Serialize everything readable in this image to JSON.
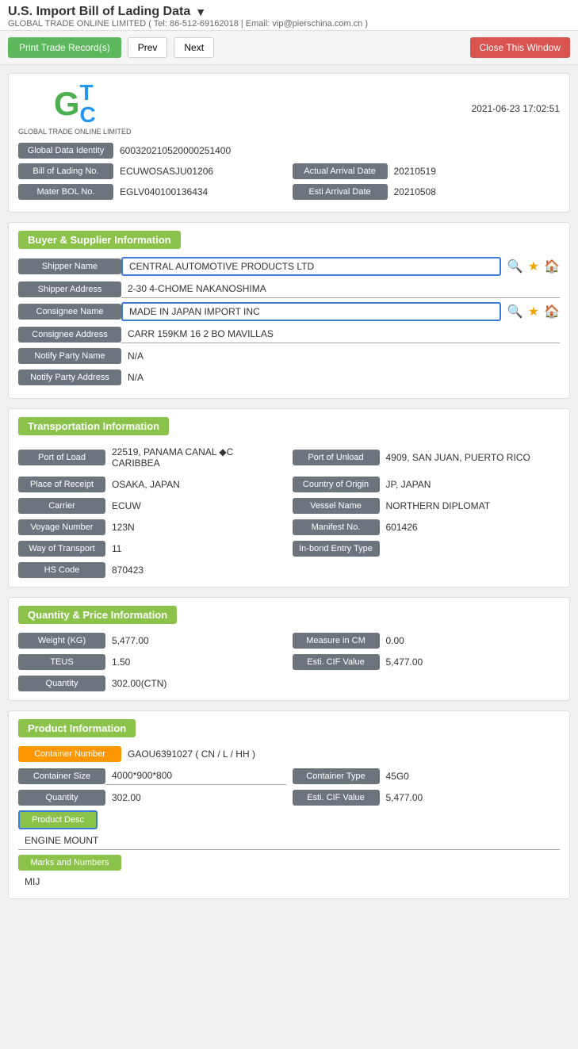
{
  "header": {
    "title": "U.S. Import Bill of Lading Data",
    "subtitle": "GLOBAL TRADE ONLINE LIMITED ( Tel: 86-512-69162018 | Email: vip@pierschina.com.cn )"
  },
  "toolbar": {
    "print_label": "Print Trade Record(s)",
    "prev_label": "Prev",
    "next_label": "Next",
    "close_label": "Close This Window"
  },
  "logo": {
    "company_name": "GLOBAL TRADE ONLINE LIMITED",
    "timestamp": "2021-06-23 17:02:51"
  },
  "basic_info": {
    "global_data_identity_label": "Global Data Identity",
    "global_data_identity_value": "600320210520000251400",
    "bill_of_lading_label": "Bill of Lading No.",
    "bill_of_lading_value": "ECUWOSASJU01206",
    "actual_arrival_label": "Actual Arrival Date",
    "actual_arrival_value": "20210519",
    "master_bol_label": "Mater BOL No.",
    "master_bol_value": "EGLV040100136434",
    "esti_arrival_label": "Esti Arrival Date",
    "esti_arrival_value": "20210508"
  },
  "buyer_supplier": {
    "section_title": "Buyer & Supplier Information",
    "shipper_name_label": "Shipper Name",
    "shipper_name_value": "CENTRAL AUTOMOTIVE PRODUCTS LTD",
    "shipper_address_label": "Shipper Address",
    "shipper_address_value": "2-30 4-CHOME NAKANOSHIMA",
    "consignee_name_label": "Consignee Name",
    "consignee_name_value": "MADE IN JAPAN IMPORT INC",
    "consignee_address_label": "Consignee Address",
    "consignee_address_value": "CARR 159KM 16 2 BO MAVILLAS",
    "notify_party_name_label": "Notify Party Name",
    "notify_party_name_value": "N/A",
    "notify_party_address_label": "Notify Party Address",
    "notify_party_address_value": "N/A"
  },
  "transportation": {
    "section_title": "Transportation Information",
    "port_of_load_label": "Port of Load",
    "port_of_load_value": "22519, PANAMA CANAL ◆C CARIBBEA",
    "port_of_unload_label": "Port of Unload",
    "port_of_unload_value": "4909, SAN JUAN, PUERTO RICO",
    "place_of_receipt_label": "Place of Receipt",
    "place_of_receipt_value": "OSAKA, JAPAN",
    "country_of_origin_label": "Country of Origin",
    "country_of_origin_value": "JP, JAPAN",
    "carrier_label": "Carrier",
    "carrier_value": "ECUW",
    "vessel_name_label": "Vessel Name",
    "vessel_name_value": "NORTHERN DIPLOMAT",
    "voyage_number_label": "Voyage Number",
    "voyage_number_value": "123N",
    "manifest_no_label": "Manifest No.",
    "manifest_no_value": "601426",
    "way_of_transport_label": "Way of Transport",
    "way_of_transport_value": "11",
    "inbond_entry_label": "In-bond Entry Type",
    "inbond_entry_value": "",
    "hs_code_label": "HS Code",
    "hs_code_value": "870423"
  },
  "quantity_price": {
    "section_title": "Quantity & Price Information",
    "weight_label": "Weight (KG)",
    "weight_value": "5,477.00",
    "measure_label": "Measure in CM",
    "measure_value": "0.00",
    "teus_label": "TEUS",
    "teus_value": "1.50",
    "esti_cif_label": "Esti. CIF Value",
    "esti_cif_value": "5,477.00",
    "quantity_label": "Quantity",
    "quantity_value": "302.00(CTN)"
  },
  "product": {
    "section_title": "Product Information",
    "container_number_label": "Container Number",
    "container_number_value": "GAOU6391027 ( CN / L / HH )",
    "container_size_label": "Container Size",
    "container_size_value": "4000*900*800",
    "container_type_label": "Container Type",
    "container_type_value": "45G0",
    "quantity_label": "Quantity",
    "quantity_value": "302.00",
    "esti_cif_label": "Esti. CIF Value",
    "esti_cif_value": "5,477.00",
    "product_desc_label": "Product Desc",
    "product_desc_value": "ENGINE MOUNT",
    "marks_label": "Marks and Numbers",
    "marks_value": "MIJ"
  }
}
